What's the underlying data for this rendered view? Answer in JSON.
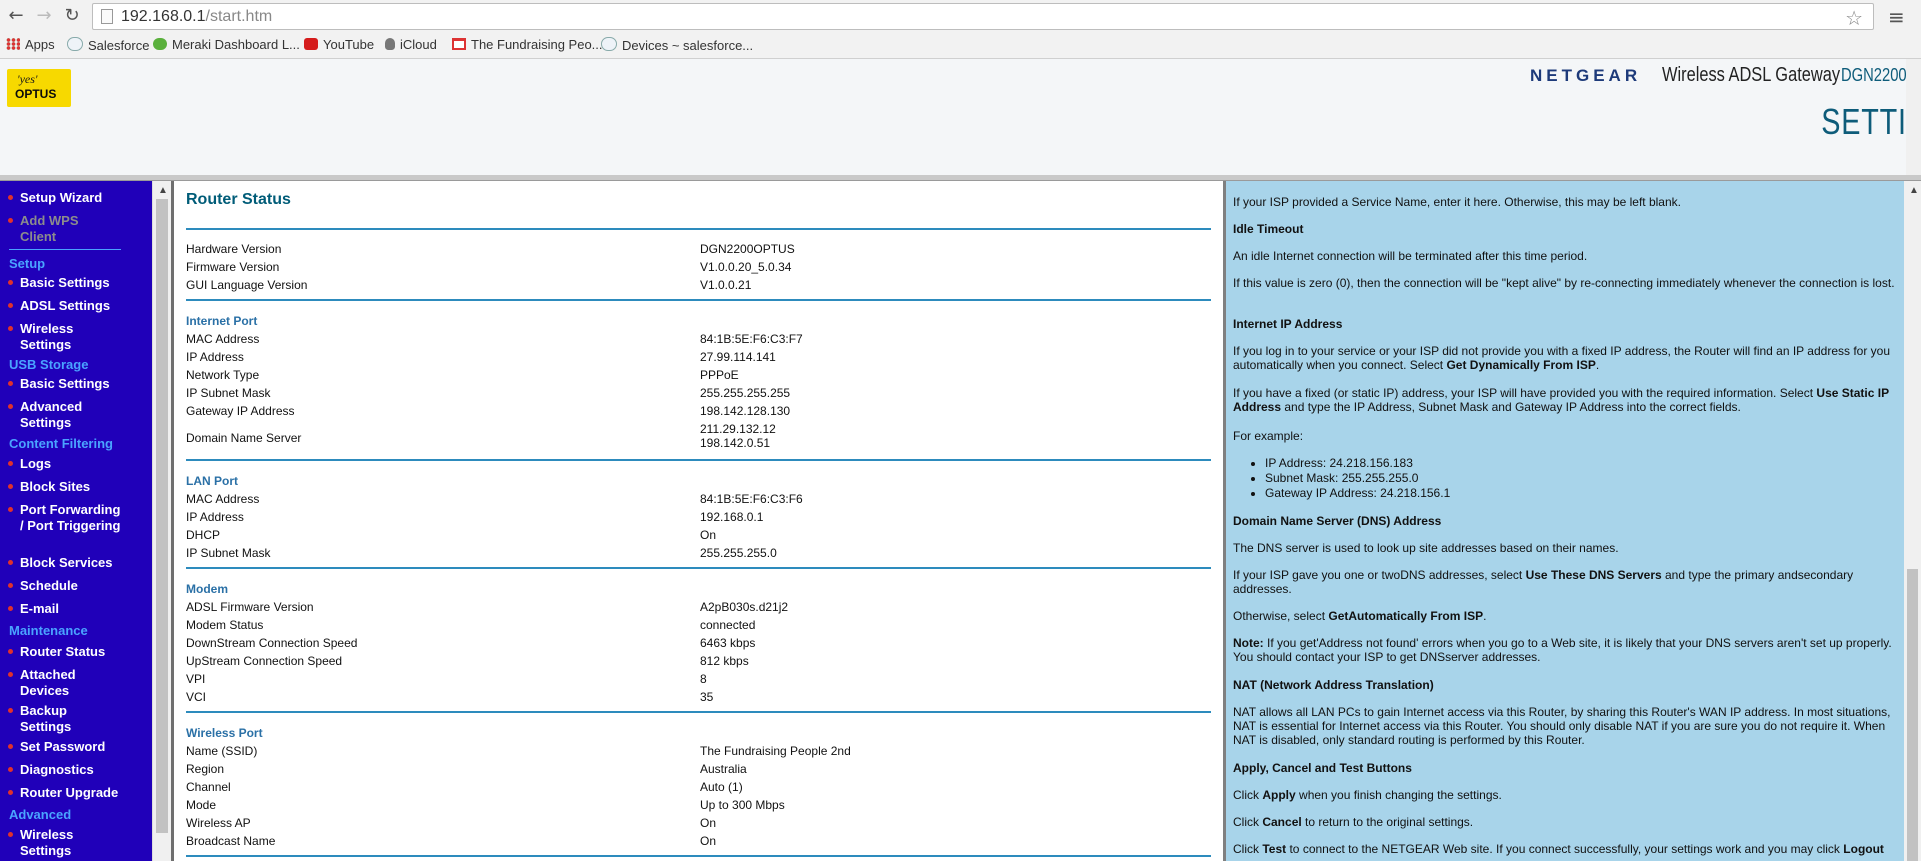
{
  "browser": {
    "url_host": "192.168.0.1",
    "url_path": "/start.htm",
    "bookmarks": [
      {
        "label": "Apps",
        "icon": "apps-grid-icon"
      },
      {
        "label": "Salesforce",
        "icon": "cloud-icon"
      },
      {
        "label": "Meraki Dashboard L...",
        "icon": "meraki-icon"
      },
      {
        "label": "YouTube",
        "icon": "youtube-icon"
      },
      {
        "label": "iCloud",
        "icon": "apple-icon"
      },
      {
        "label": "The Fundraising Peo...",
        "icon": "gmail-icon"
      },
      {
        "label": "Devices ~ salesforce...",
        "icon": "cloud-icon"
      }
    ]
  },
  "header": {
    "logo_top": "'yes'",
    "logo_bottom": "OPTUS",
    "brand": "NETGEAR",
    "product": "Wireless ADSL Gateway",
    "model": "DGN2200",
    "section": "SETTING"
  },
  "nav": {
    "setup_wizard": "Setup Wizard",
    "add_wps": "Add WPS Client",
    "setup": "Setup",
    "basic_settings": "Basic Settings",
    "adsl_settings": "ADSL Settings",
    "wireless_settings": "Wireless Settings",
    "usb_storage": "USB Storage",
    "usb_basic": "Basic Settings",
    "usb_advanced": "Advanced Settings",
    "content_filtering": "Content Filtering",
    "logs": "Logs",
    "block_sites": "Block Sites",
    "port_forwarding": "Port Forwarding / Port Triggering",
    "block_services": "Block Services",
    "schedule": "Schedule",
    "email": "E-mail",
    "maintenance": "Maintenance",
    "router_status": "Router Status",
    "attached_devices": "Attached Devices",
    "backup_settings": "Backup Settings",
    "set_password": "Set Password",
    "diagnostics": "Diagnostics",
    "router_upgrade": "Router Upgrade",
    "advanced": "Advanced",
    "adv_wireless": "Wireless Settings"
  },
  "status": {
    "title": "Router Status",
    "general": [
      {
        "label": "Hardware Version",
        "value": "DGN2200OPTUS"
      },
      {
        "label": "Firmware Version",
        "value": "V1.0.0.20_5.0.34"
      },
      {
        "label": "GUI Language Version",
        "value": "V1.0.0.21"
      }
    ],
    "internet_title": "Internet Port",
    "internet": [
      {
        "label": "MAC Address",
        "value": "84:1B:5E:F6:C3:F7"
      },
      {
        "label": "IP Address",
        "value": "27.99.114.141"
      },
      {
        "label": "Network Type",
        "value": "PPPoE"
      },
      {
        "label": "IP Subnet Mask",
        "value": "255.255.255.255"
      },
      {
        "label": "Gateway IP Address",
        "value": "198.142.128.130"
      }
    ],
    "dns_label": "Domain Name Server",
    "dns1": "211.29.132.12",
    "dns2": "198.142.0.51",
    "lan_title": "LAN Port",
    "lan": [
      {
        "label": "MAC Address",
        "value": "84:1B:5E:F6:C3:F6"
      },
      {
        "label": "IP Address",
        "value": "192.168.0.1"
      },
      {
        "label": "DHCP",
        "value": "On"
      },
      {
        "label": "IP Subnet Mask",
        "value": "255.255.255.0"
      }
    ],
    "modem_title": "Modem",
    "modem": [
      {
        "label": "ADSL Firmware Version",
        "value": "A2pB030s.d21j2"
      },
      {
        "label": "Modem Status",
        "value": "connected"
      },
      {
        "label": "DownStream Connection Speed",
        "value": "6463 kbps"
      },
      {
        "label": "UpStream Connection Speed",
        "value": "812 kbps"
      },
      {
        "label": "VPI",
        "value": "8"
      },
      {
        "label": "VCI",
        "value": "35"
      }
    ],
    "wireless_title": "Wireless Port",
    "wireless": [
      {
        "label": "Name (SSID)",
        "value": "The Fundraising People 2nd"
      },
      {
        "label": "Region",
        "value": "Australia"
      },
      {
        "label": "Channel",
        "value": "Auto (1)"
      },
      {
        "label": "Mode",
        "value": "Up to 300 Mbps"
      },
      {
        "label": "Wireless AP",
        "value": "On"
      },
      {
        "label": "Broadcast Name",
        "value": "On"
      }
    ]
  },
  "help": {
    "p1": "If your ISP provided a Service Name, enter it here. Otherwise, this may be left blank.",
    "h_idle": "Idle Timeout",
    "p2": "An idle Internet connection will be terminated after this time period.",
    "p3": "If this value is zero (0), then the connection will be \"kept alive\" by re-connecting immediately whenever the connection is lost.",
    "h_ip": "Internet IP Address",
    "p4a": "If you log in to your service or your ISP did not provide you with a fixed IP address, the Router will find an IP address for you automatically when you connect. Select ",
    "p4b": "Get Dynamically From ISP",
    "p4c": ".",
    "p5a": "If you have a fixed (or static IP) address, your ISP will have provided you with the required information. Select ",
    "p5b": "Use Static IP Address",
    "p5c": " and type the IP Address, Subnet Mask and Gateway IP Address into the correct fields.",
    "p6": "For example:",
    "li1": "IP Address: 24.218.156.183",
    "li2": "Subnet Mask: 255.255.255.0",
    "li3": "Gateway IP Address: 24.218.156.1",
    "h_dns": "Domain Name Server (DNS) Address",
    "p7": "The DNS server is used to look up site addresses based on their names.",
    "p8a": "If your ISP gave you one or twoDNS addresses, select ",
    "p8b": "Use These DNS Servers",
    "p8c": " and type the primary andsecondary addresses.",
    "p9a": "Otherwise, select ",
    "p9b": "GetAutomatically From ISP",
    "p9c": ".",
    "p10a": "Note:",
    "p10b": " If you get'Address not found' errors when you go to a Web site, it is likely that your DNS servers aren't set up properly. You should contact your ISP to get DNSserver addresses.",
    "h_nat": "NAT (Network Address Translation)",
    "p11": "NAT allows all LAN PCs to gain Internet access via this Router, by sharing this Router's WAN IP address. In most situations, NAT is essential for Internet access via this Router. You should only disable NAT if you are sure you do not require it. When NAT is disabled, only standard routing is performed by this Router.",
    "h_apply": "Apply, Cancel and Test Buttons",
    "p12a": "Click ",
    "p12b": "Apply",
    "p12c": " when you finish changing the settings.",
    "p13a": "Click ",
    "p13b": "Cancel",
    "p13c": " to return to the original settings.",
    "p14a": "Click ",
    "p14b": "Test",
    "p14c": " to connect to the NETGEAR Web site. If you connect successfully, your settings work and you may click ",
    "p14d": "Logout"
  }
}
